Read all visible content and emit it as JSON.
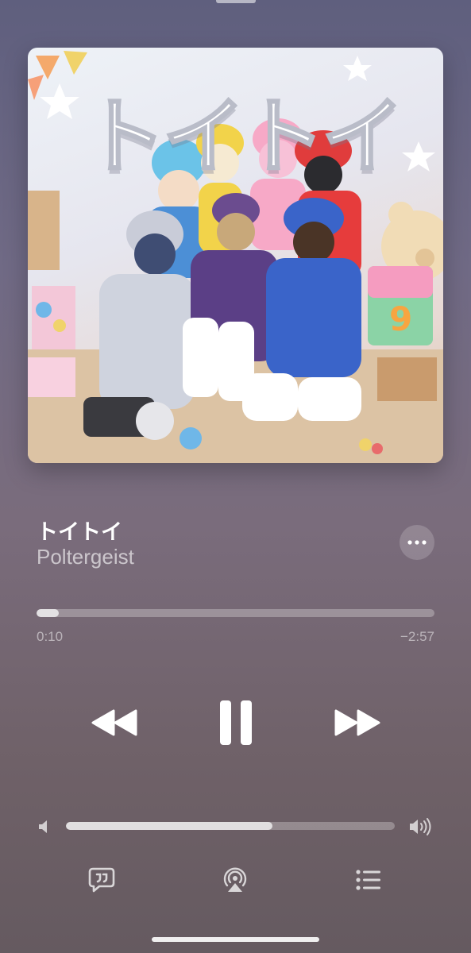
{
  "album_art": {
    "artwork_title": "トイトイ",
    "dice_number": "9"
  },
  "track": {
    "title": "トイトイ",
    "artist": "Poltergeist"
  },
  "playback": {
    "elapsed": "0:10",
    "remaining": "−2:57",
    "progress_fraction": 0.055,
    "state": "playing"
  },
  "volume": {
    "level_fraction": 0.627
  },
  "icons": {
    "more": "ellipsis-icon",
    "rewind": "rewind-icon",
    "pause": "pause-icon",
    "forward": "fast-forward-icon",
    "volume_low": "speaker-low-icon",
    "volume_high": "speaker-high-icon",
    "lyrics": "lyrics-bubble-icon",
    "airplay": "airplay-icon",
    "queue": "queue-list-icon"
  },
  "colors": {
    "background_top": "#5f5f7e",
    "background_bottom": "#655a60",
    "accent": "#ffffff"
  }
}
